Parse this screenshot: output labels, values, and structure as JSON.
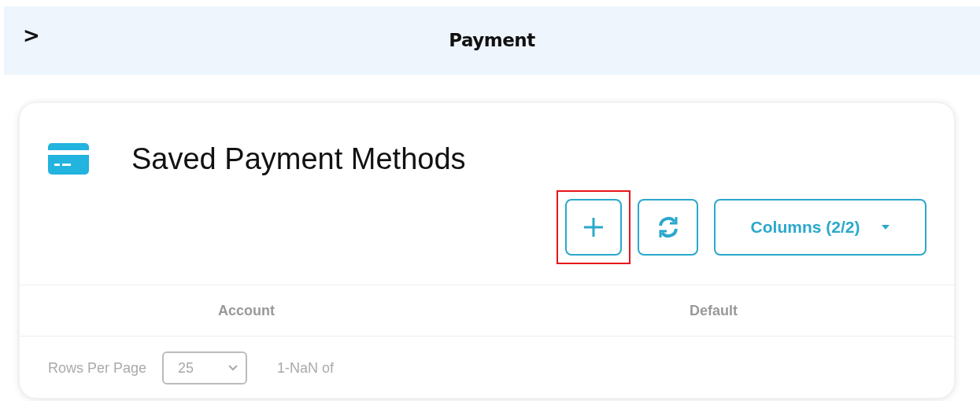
{
  "header": {
    "title": "Payment",
    "toggle": ">"
  },
  "card": {
    "title": "Saved Payment Methods",
    "toolbar": [
      {
        "kind": "add",
        "highlighted": true
      },
      {
        "kind": "refresh",
        "highlighted": false
      },
      {
        "kind": "columns",
        "label": "Columns (2/2)",
        "highlighted": false
      }
    ],
    "table": {
      "columns": [
        "Account",
        "Default"
      ]
    },
    "footer": {
      "rows_label": "Rows Per Page",
      "rows_value": "25",
      "range": "1-NaN of"
    }
  }
}
